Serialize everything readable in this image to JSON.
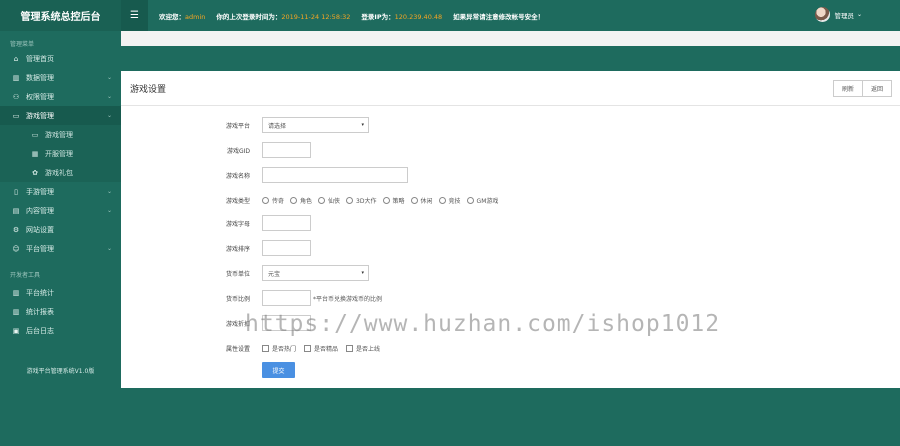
{
  "brand": "管理系统总控后台",
  "topbar": {
    "welcome_label": "欢迎您：",
    "welcome_user": "admin",
    "last_login_label": "你的上次登录时间为：",
    "last_login_time": "2019-11-24 12:58:32",
    "ip_label": "登录IP为：",
    "ip_value": "120.239.40.48",
    "notice": "如果异常请注意修改帐号安全！",
    "user_name": "管理员"
  },
  "sidebar": {
    "section_main": "管理菜单",
    "items": [
      {
        "label": "管理首页",
        "icon": "home-icon"
      },
      {
        "label": "数据管理",
        "icon": "chart-icon"
      },
      {
        "label": "权限管理",
        "icon": "group-icon"
      },
      {
        "label": "游戏管理",
        "icon": "gamepad-icon"
      }
    ],
    "sub_items": [
      {
        "label": "游戏管理",
        "icon": "gamepad-icon"
      },
      {
        "label": "开服管理",
        "icon": "calendar-icon"
      },
      {
        "label": "游戏礼包",
        "icon": "gift-icon"
      }
    ],
    "items2": [
      {
        "label": "手游管理",
        "icon": "mobile-icon"
      },
      {
        "label": "内容管理",
        "icon": "file-icon"
      },
      {
        "label": "网站设置",
        "icon": "gear-icon"
      },
      {
        "label": "平台管理",
        "icon": "user-icon"
      }
    ],
    "section_stats": "开发者工具",
    "stats_items": [
      {
        "label": "平台统计",
        "icon": "chart-icon"
      },
      {
        "label": "统计报表",
        "icon": "chart-icon"
      },
      {
        "label": "后台日志",
        "icon": "log-icon"
      }
    ],
    "version": "游戏平台管理系统V1.0版"
  },
  "panel": {
    "title": "游戏设置",
    "btn_refresh": "刷新",
    "btn_back": "返回"
  },
  "form": {
    "platform_label": "游戏平台",
    "platform_value": "请选择",
    "gid_label": "游戏GID",
    "name_label": "游戏名称",
    "type_label": "游戏类型",
    "types": [
      "传奇",
      "角色",
      "仙侠",
      "3D大作",
      "策略",
      "休闲",
      "竞技",
      "GM游戏"
    ],
    "letter_label": "游戏字母",
    "order_label": "游戏排序",
    "currency_label": "货币单位",
    "currency_value": "元宝",
    "ratio_label": "货币比例",
    "ratio_hint": "*平台币兑换游戏币的比例",
    "discount_label": "游戏折扣",
    "attr_label": "属性设置",
    "attrs": [
      "是否热门",
      "是否精品",
      "是否上线"
    ],
    "submit": "提交"
  },
  "watermark": "https://www.huzhan.com/ishop1012"
}
